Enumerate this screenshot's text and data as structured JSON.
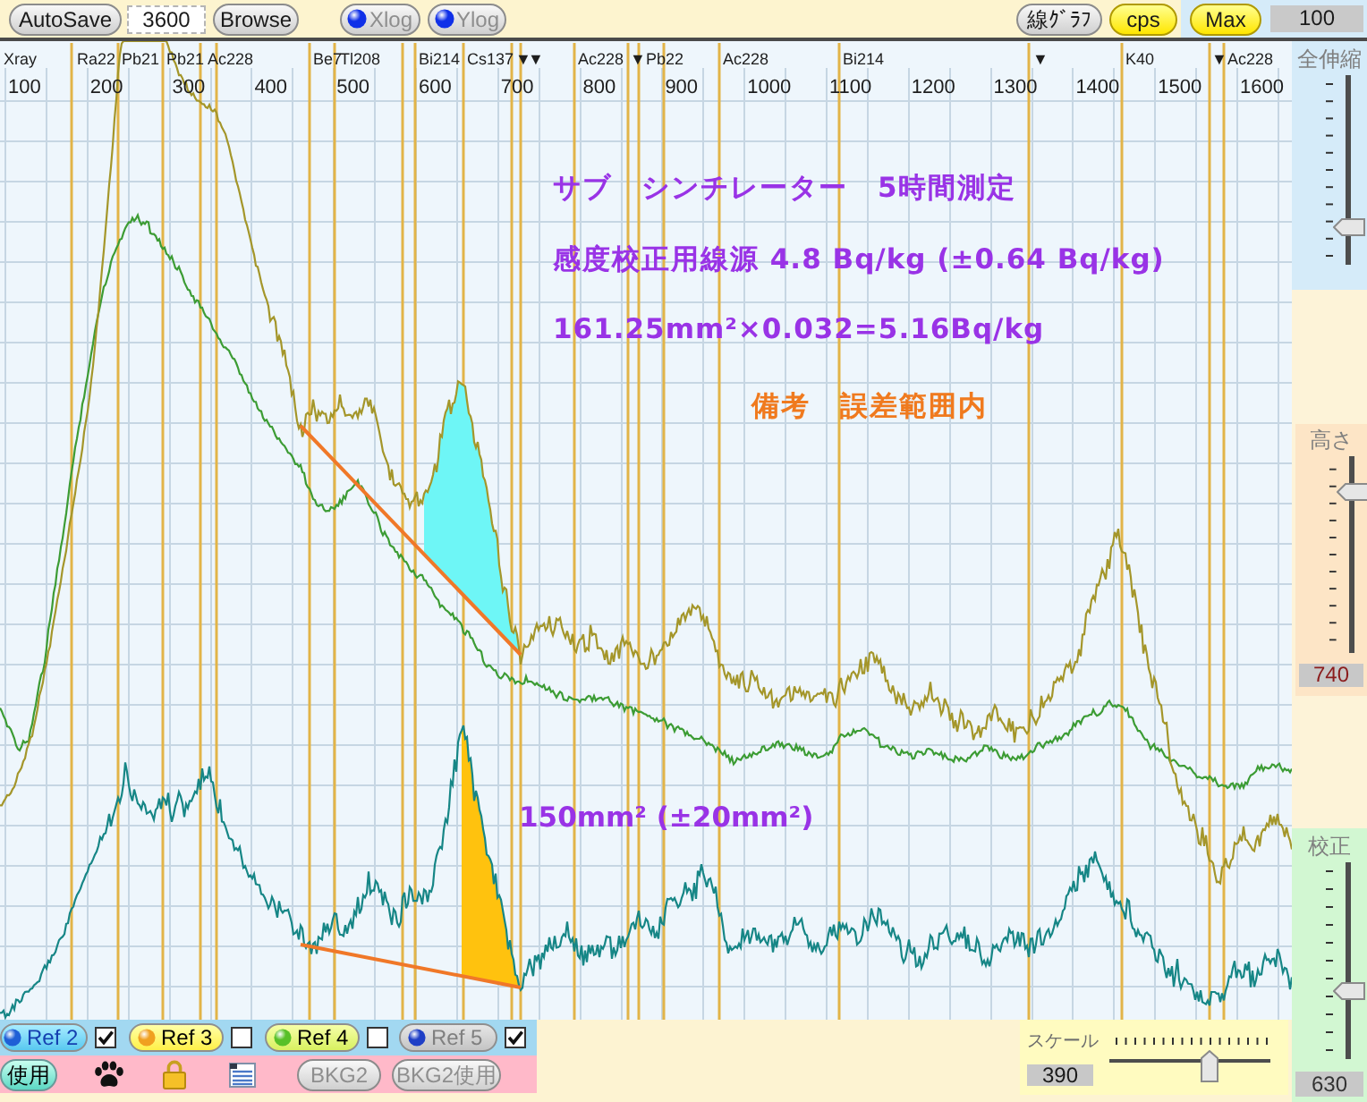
{
  "toolbar": {
    "autosave_button": {
      "label": "AutoSave"
    },
    "interval_field": {
      "value": "3600"
    },
    "browse_button": {
      "label": "Browse"
    },
    "log_toggles": [
      {
        "label": "Xlog",
        "disabled": true
      },
      {
        "label": "Ylog",
        "disabled": true
      }
    ],
    "line_graph_button": {
      "label": "線ｸﾞﾗﾌ"
    },
    "unit_buttons": [
      {
        "label": "cps"
      },
      {
        "label": "Max"
      }
    ],
    "value_display": "100"
  },
  "spectrum": {
    "isotope_labels": [
      "Xray",
      "Ra22",
      "Pb21",
      "Pb21",
      "Ac228",
      "Be7",
      "Tl208",
      "Bi214",
      "Cs137",
      "▼",
      "▼",
      "Ac228",
      "▼",
      "Pb22",
      "Ac228",
      "Bi214",
      "▼",
      "K40",
      "▼",
      "Ac228"
    ],
    "x_tick_labels": [
      "100",
      "200",
      "300",
      "400",
      "500",
      "600",
      "700",
      "800",
      "900",
      "1000",
      "1100",
      "1200",
      "1300",
      "1400",
      "1500",
      "1600"
    ],
    "notes": [
      {
        "text": "サブ　シンチレーター　5時間測定",
        "color": "#9933e6"
      },
      {
        "text": "感度校正用線源 4.8 Bq/kg (±0.64 Bq/kg)",
        "color": "#9933e6"
      },
      {
        "text": "161.25mm²×0.032=5.16Bq/kg",
        "color": "#9933e6"
      },
      {
        "text": "備考　誤差範囲内",
        "color": "#f07a1e"
      }
    ],
    "peak_area_label": "150mm² (±20mm²)"
  },
  "right_panel": {
    "sliders": [
      {
        "label": "全伸縮",
        "level": 0.17
      },
      {
        "label": "高さ",
        "value": "740",
        "level": 0.85
      },
      {
        "label": "校正",
        "value": "630",
        "level": 0.33
      }
    ]
  },
  "bottom_bar": {
    "references": [
      {
        "label": "Ref 2",
        "color": "#1f5fd6",
        "checked": true,
        "disabled": false
      },
      {
        "label": "Ref 3",
        "color": "#f0a020",
        "checked": false,
        "disabled": false
      },
      {
        "label": "Ref 4",
        "color": "#58c028",
        "checked": false,
        "disabled": false
      },
      {
        "label": "Ref 5",
        "color": "#1f3fc6",
        "checked": true,
        "disabled": true
      }
    ],
    "use_button": {
      "label": "使用"
    },
    "bkg_buttons": [
      {
        "label": "BKG2",
        "disabled": true
      },
      {
        "label": "BKG2使用",
        "disabled": true
      }
    ],
    "scale": {
      "label": "スケール",
      "value": "390",
      "level": 0.64
    }
  }
}
